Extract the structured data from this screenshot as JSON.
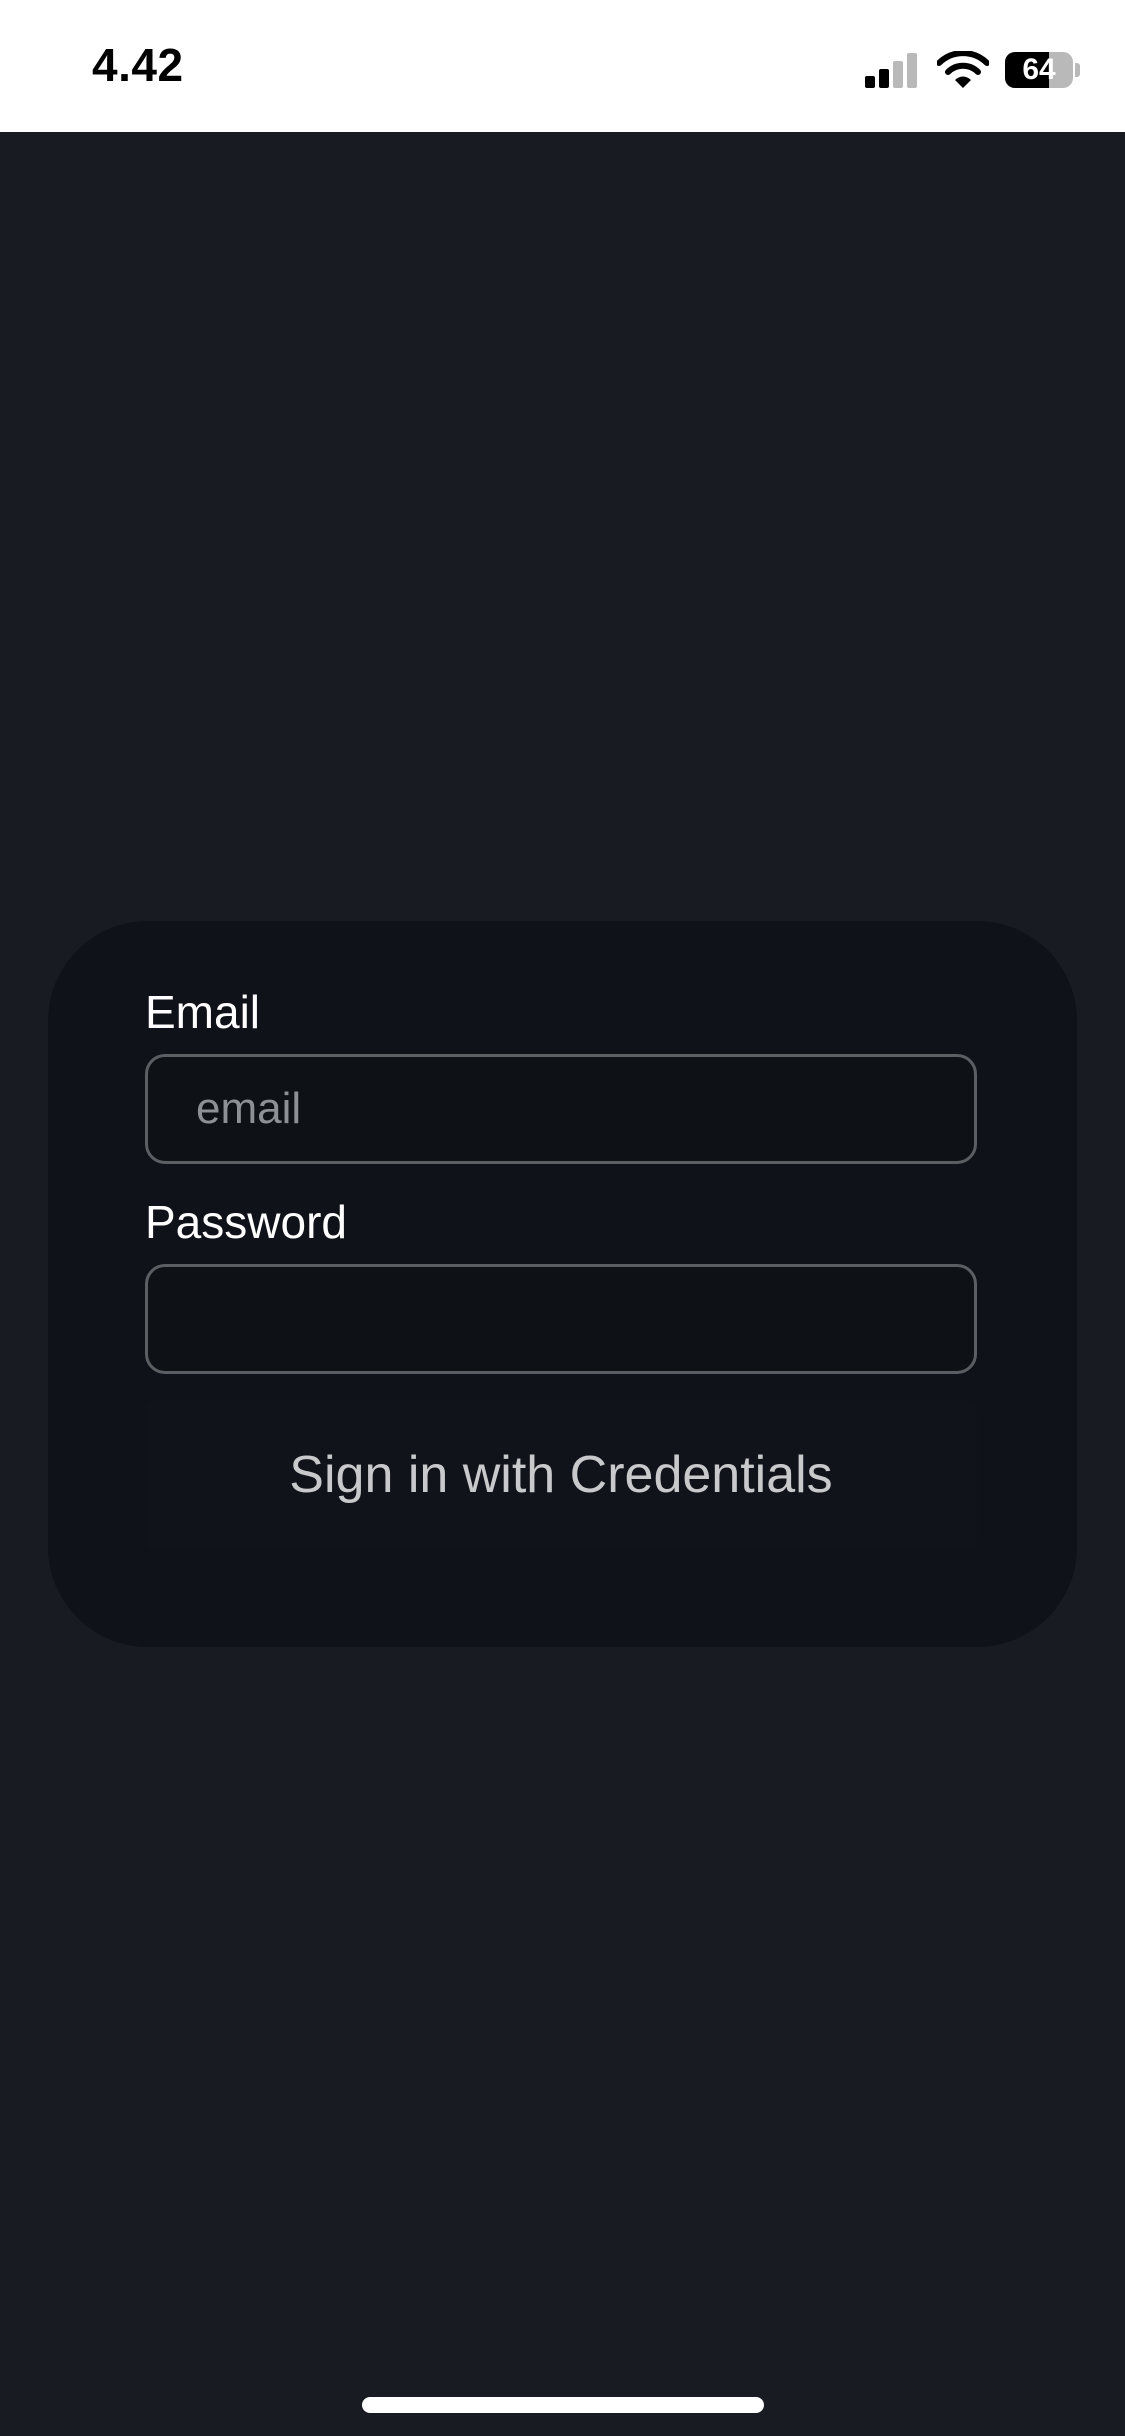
{
  "status_bar": {
    "time": "4.42",
    "battery_level": "64",
    "battery_fraction": 0.64,
    "icons": [
      "signal-icon",
      "wifi-icon",
      "battery-icon"
    ]
  },
  "login_form": {
    "email_label": "Email",
    "email_placeholder": "email",
    "email_value": "",
    "password_label": "Password",
    "password_value": "",
    "submit_label": "Sign in with Credentials"
  },
  "colors": {
    "background": "#181b22",
    "card": "#0f1218",
    "input_border": "#5b5e63",
    "status_bar": "#ffffff"
  }
}
